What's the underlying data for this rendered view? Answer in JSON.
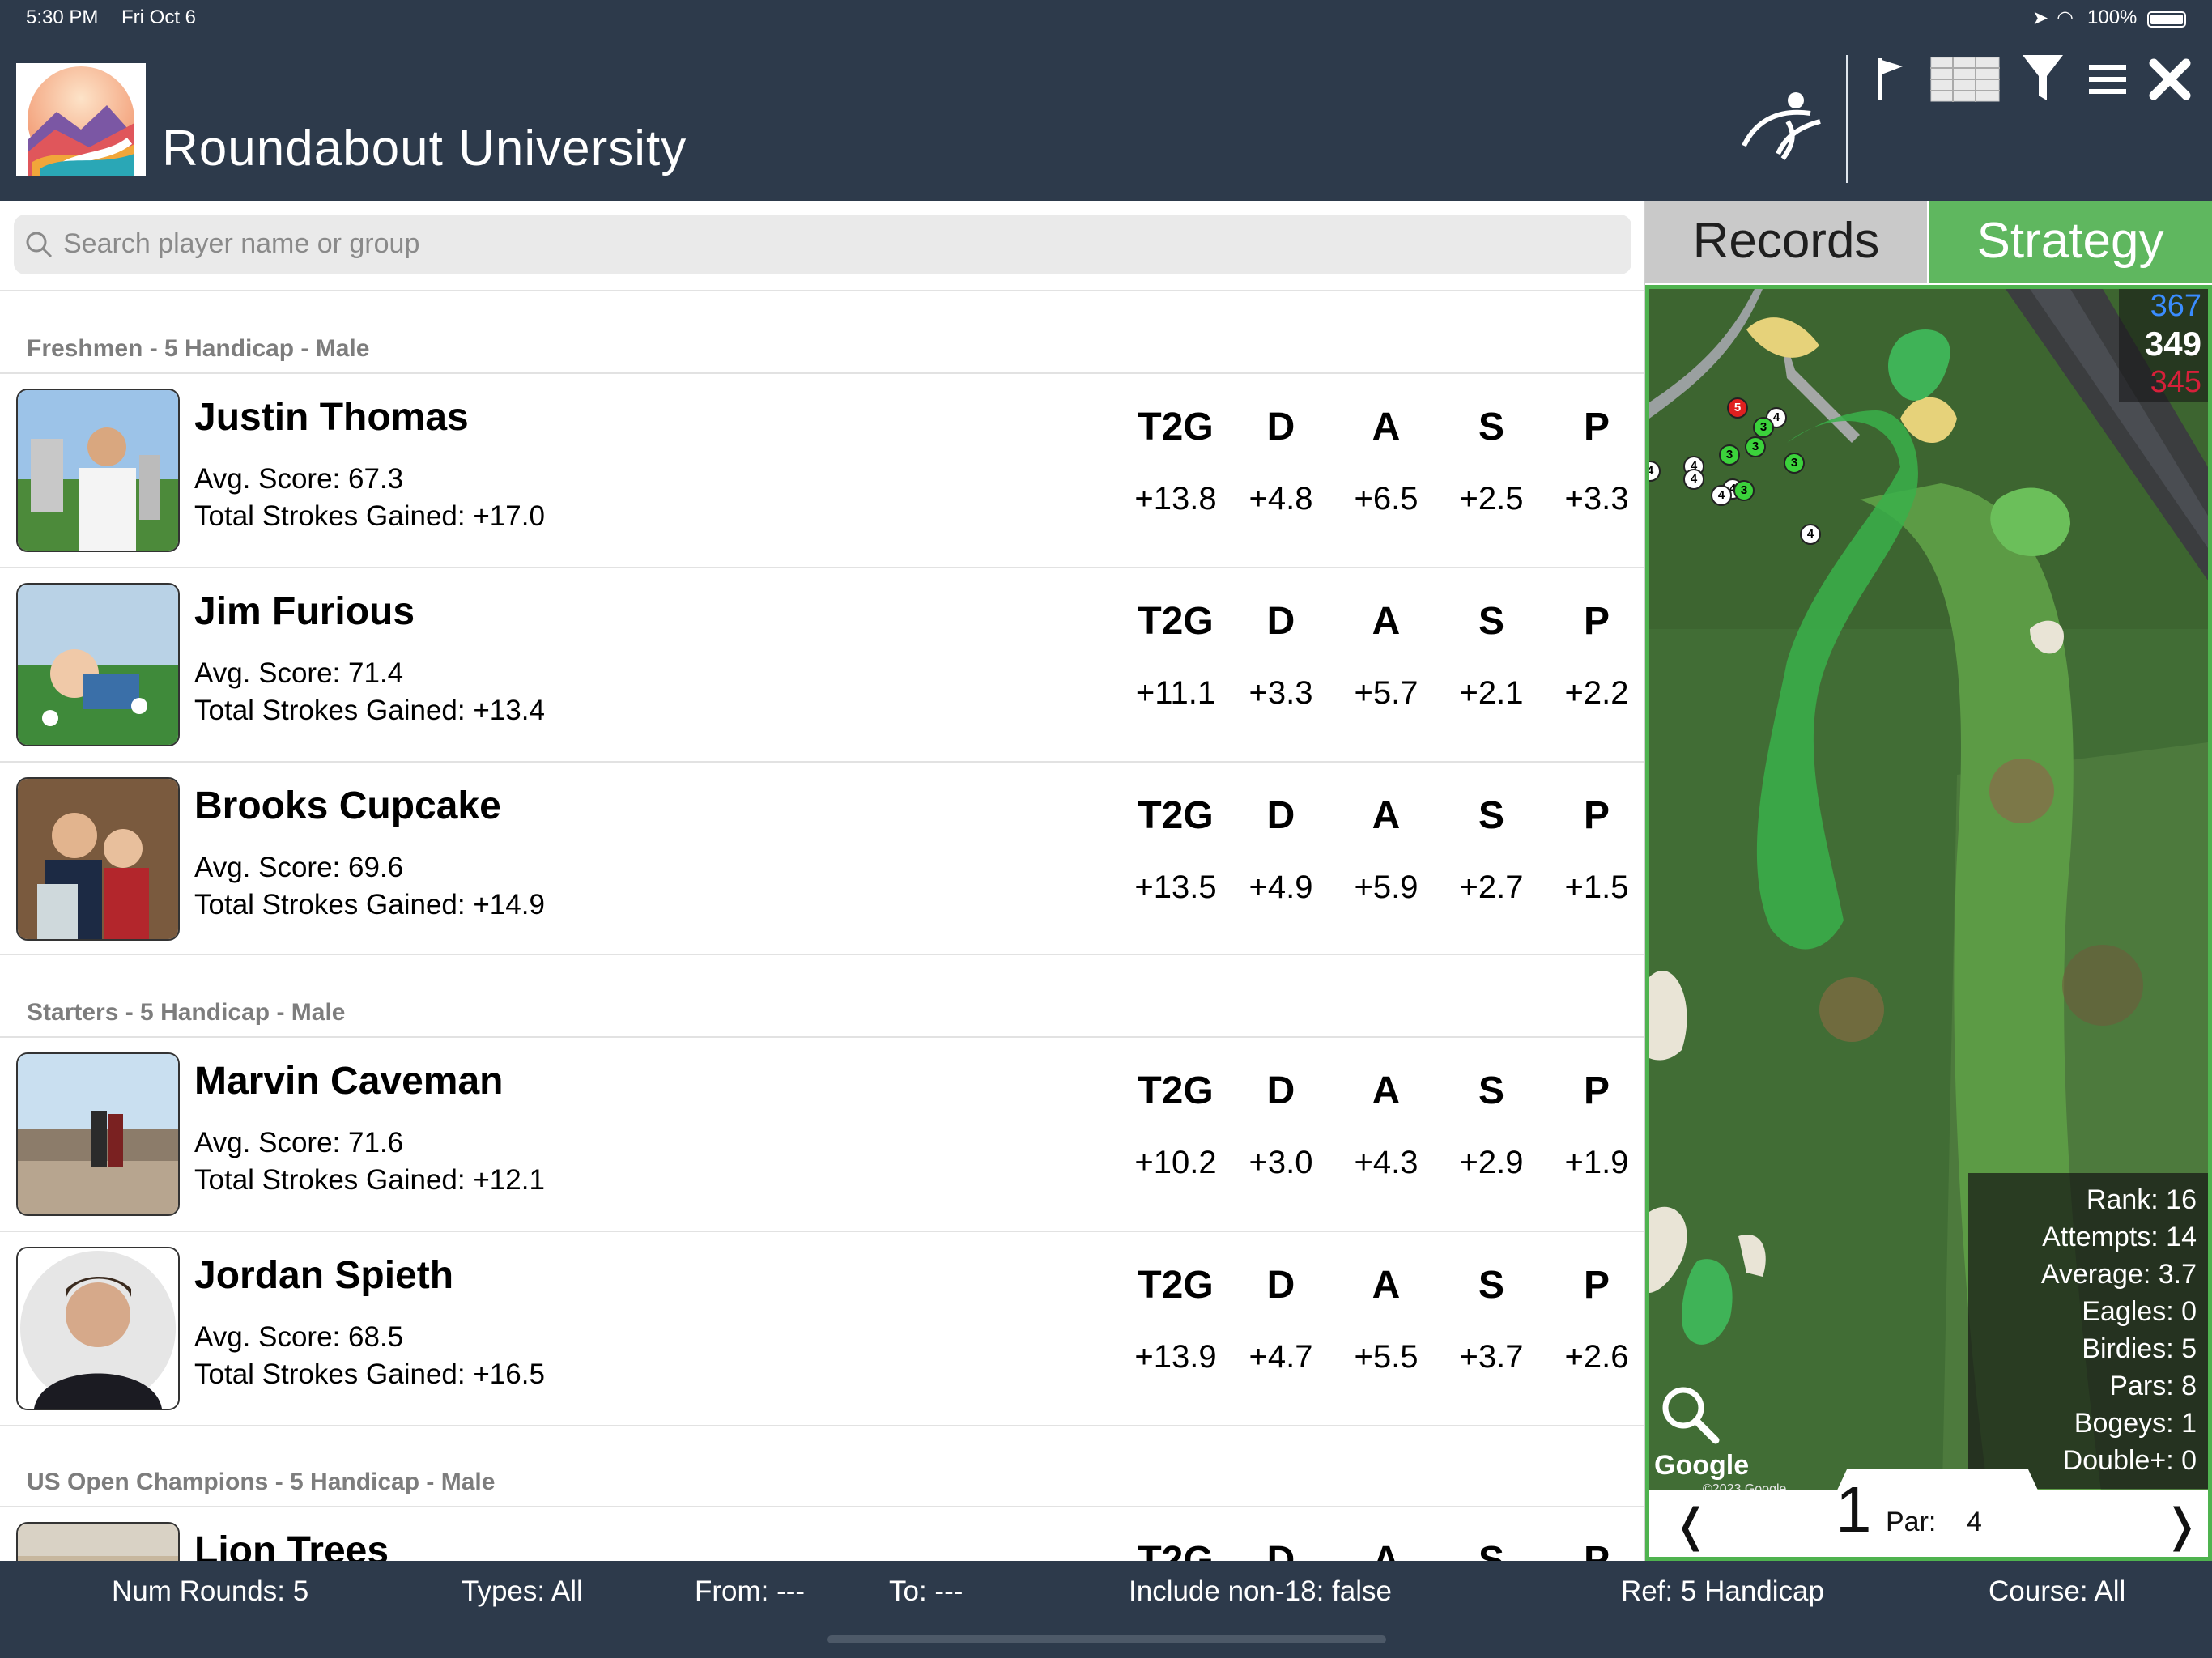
{
  "status_bar": {
    "time": "5:30 PM",
    "date": "Fri Oct 6",
    "battery": "100%"
  },
  "header": {
    "title": "Roundabout University",
    "icons": [
      "golfer-logo-icon",
      "flag-icon",
      "table-grid-icon",
      "filter-icon",
      "menu-icon",
      "close-icon"
    ]
  },
  "search": {
    "placeholder": "Search player name or group"
  },
  "stat_headers": [
    "T2G",
    "D",
    "A",
    "S",
    "P"
  ],
  "groups": [
    {
      "label": "Freshmen - 5 Handicap - Male",
      "players": [
        {
          "name": "Justin Thomas",
          "avg": "Avg. Score: 67.3",
          "total": "Total Strokes Gained: +17.0",
          "stats": [
            "+13.8",
            "+4.8",
            "+6.5",
            "+2.5",
            "+3.3"
          ]
        },
        {
          "name": "Jim Furious",
          "avg": "Avg. Score: 71.4",
          "total": "Total Strokes Gained: +13.4",
          "stats": [
            "+11.1",
            "+3.3",
            "+5.7",
            "+2.1",
            "+2.2"
          ]
        },
        {
          "name": "Brooks Cupcake",
          "avg": "Avg. Score: 69.6",
          "total": "Total Strokes Gained: +14.9",
          "stats": [
            "+13.5",
            "+4.9",
            "+5.9",
            "+2.7",
            "+1.5"
          ]
        }
      ]
    },
    {
      "label": "Starters - 5 Handicap - Male",
      "players": [
        {
          "name": "Marvin Caveman",
          "avg": "Avg. Score: 71.6",
          "total": "Total Strokes Gained: +12.1",
          "stats": [
            "+10.2",
            "+3.0",
            "+4.3",
            "+2.9",
            "+1.9"
          ]
        },
        {
          "name": "Jordan Spieth",
          "avg": "Avg. Score: 68.5",
          "total": "Total Strokes Gained: +16.5",
          "stats": [
            "+13.9",
            "+4.7",
            "+5.5",
            "+3.7",
            "+2.6"
          ]
        }
      ]
    },
    {
      "label": "US Open Champions - 5 Handicap - Male",
      "players": [
        {
          "name": "Lion Trees",
          "avg": "",
          "total": "",
          "stats": [
            "",
            "",
            "",
            "",
            ""
          ]
        }
      ]
    }
  ],
  "tabs": {
    "records": "Records",
    "strategy": "Strategy"
  },
  "map": {
    "yardages": {
      "blue": "367",
      "white": "349",
      "red": "345"
    },
    "attribution": "Google",
    "copyright": "©2023 Google",
    "stats": {
      "rank": "Rank: 16",
      "attempts": "Attempts: 14",
      "average": "Average: 3.7",
      "eagles": "Eagles: 0",
      "birdies": "Birdies: 5",
      "pars": "Pars: 8",
      "bogeys": "Bogeys: 1",
      "double": "Double+: 0"
    },
    "hole": {
      "number": "1",
      "par_label": "Par:",
      "par_value": "4",
      "prev": "❬",
      "next": "❭"
    },
    "markers": [
      "5",
      "4",
      "3",
      "3",
      "3",
      "3",
      "4",
      "4",
      "4",
      "4",
      "3",
      "4",
      "4"
    ]
  },
  "footer": {
    "rounds": "Num Rounds: 5",
    "types": "Types: All",
    "from": "From: ---",
    "to": "To: ---",
    "non18": "Include non-18: false",
    "ref": "Ref: 5 Handicap",
    "course": "Course: All"
  },
  "colors": {
    "header_bg": "#2d3a4b",
    "strategy_tab": "#5fb75f",
    "records_tab": "#c9c9c9",
    "map_border": "#4fb34f"
  }
}
